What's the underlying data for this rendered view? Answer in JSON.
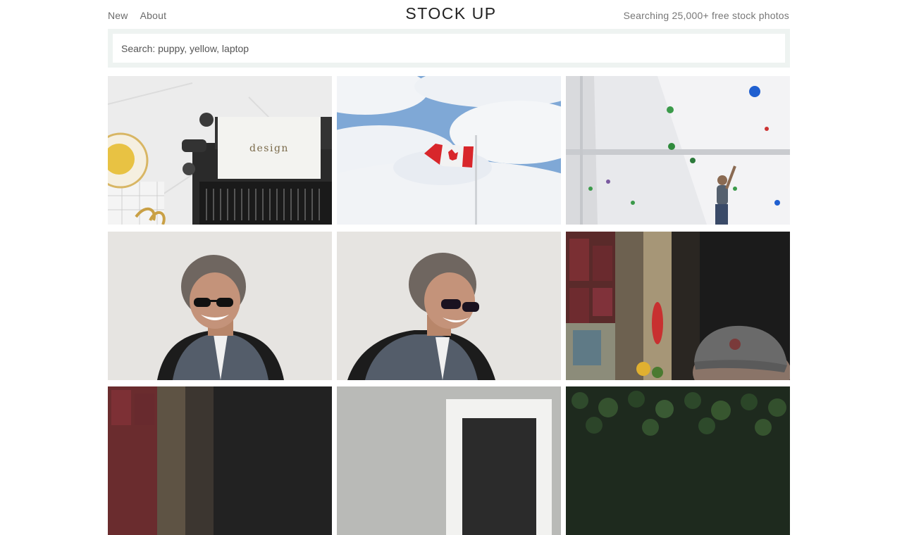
{
  "nav": {
    "new_label": "New",
    "about_label": "About"
  },
  "header": {
    "title": "STOCK UP",
    "tagline": "Searching 25,000+ free stock photos"
  },
  "search": {
    "placeholder": "Search: puppy, yellow, laptop",
    "value": ""
  },
  "photos": [
    {
      "subject": "typewriter-design",
      "typed_text": "design"
    },
    {
      "subject": "canadian-flag-sky"
    },
    {
      "subject": "climbing-wall"
    },
    {
      "subject": "woman-sunglasses-smiling"
    },
    {
      "subject": "woman-sunglasses-laughing"
    },
    {
      "subject": "man-cap-storefront"
    },
    {
      "subject": "storefront-partial"
    },
    {
      "subject": "frame-on-wall-partial"
    },
    {
      "subject": "leaves-partial"
    }
  ]
}
